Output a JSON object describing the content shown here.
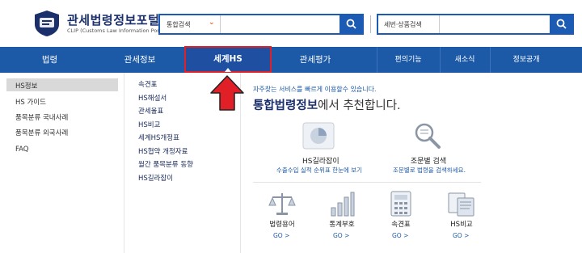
{
  "header": {
    "logo_title": "관세법령정보포털",
    "logo_sub": "CLIP (Customs Law Information Portal)",
    "search_type": "통합검색",
    "search2_placeholder": "세번·상품검색"
  },
  "nav": {
    "items": [
      "법령",
      "관세정보",
      "세계HS",
      "관세평가",
      "편의기능",
      "새소식",
      "정보공개"
    ],
    "active": "세계HS"
  },
  "sidebar": {
    "items": [
      "HS정보",
      "HS 가이드",
      "품목분류 국내사례",
      "품목분류 외국사례",
      "FAQ"
    ]
  },
  "submenu": {
    "items": [
      "속견표",
      "HS해설서",
      "관세율표",
      "HS비교",
      "세계HS개정표",
      "HS협약 개정자료",
      "월간 품목분류 동향",
      "HS길라잡이"
    ]
  },
  "content": {
    "top_text": "자주찾는 서비스를 빠르게 이용할수 있습니다.",
    "title_bold": "통합법령정보",
    "title_rest": "에서 추천합니다.",
    "features": [
      {
        "title": "HS길라잡이",
        "desc": "수출수입 실적 순위표 한눈에 보기"
      },
      {
        "title": "조문별 검색",
        "desc": "조문별로 법령을 검색하세요."
      }
    ],
    "quick": [
      {
        "title": "법령용어",
        "go": "GO >"
      },
      {
        "title": "통계부호",
        "go": "GO >"
      },
      {
        "title": "속견표",
        "go": "GO >"
      },
      {
        "title": "HS비교",
        "go": "GO >"
      }
    ]
  },
  "colors": {
    "nav_bg": "#1c5aa8",
    "highlight": "#e01f26",
    "accent": "#1c5bb3"
  }
}
